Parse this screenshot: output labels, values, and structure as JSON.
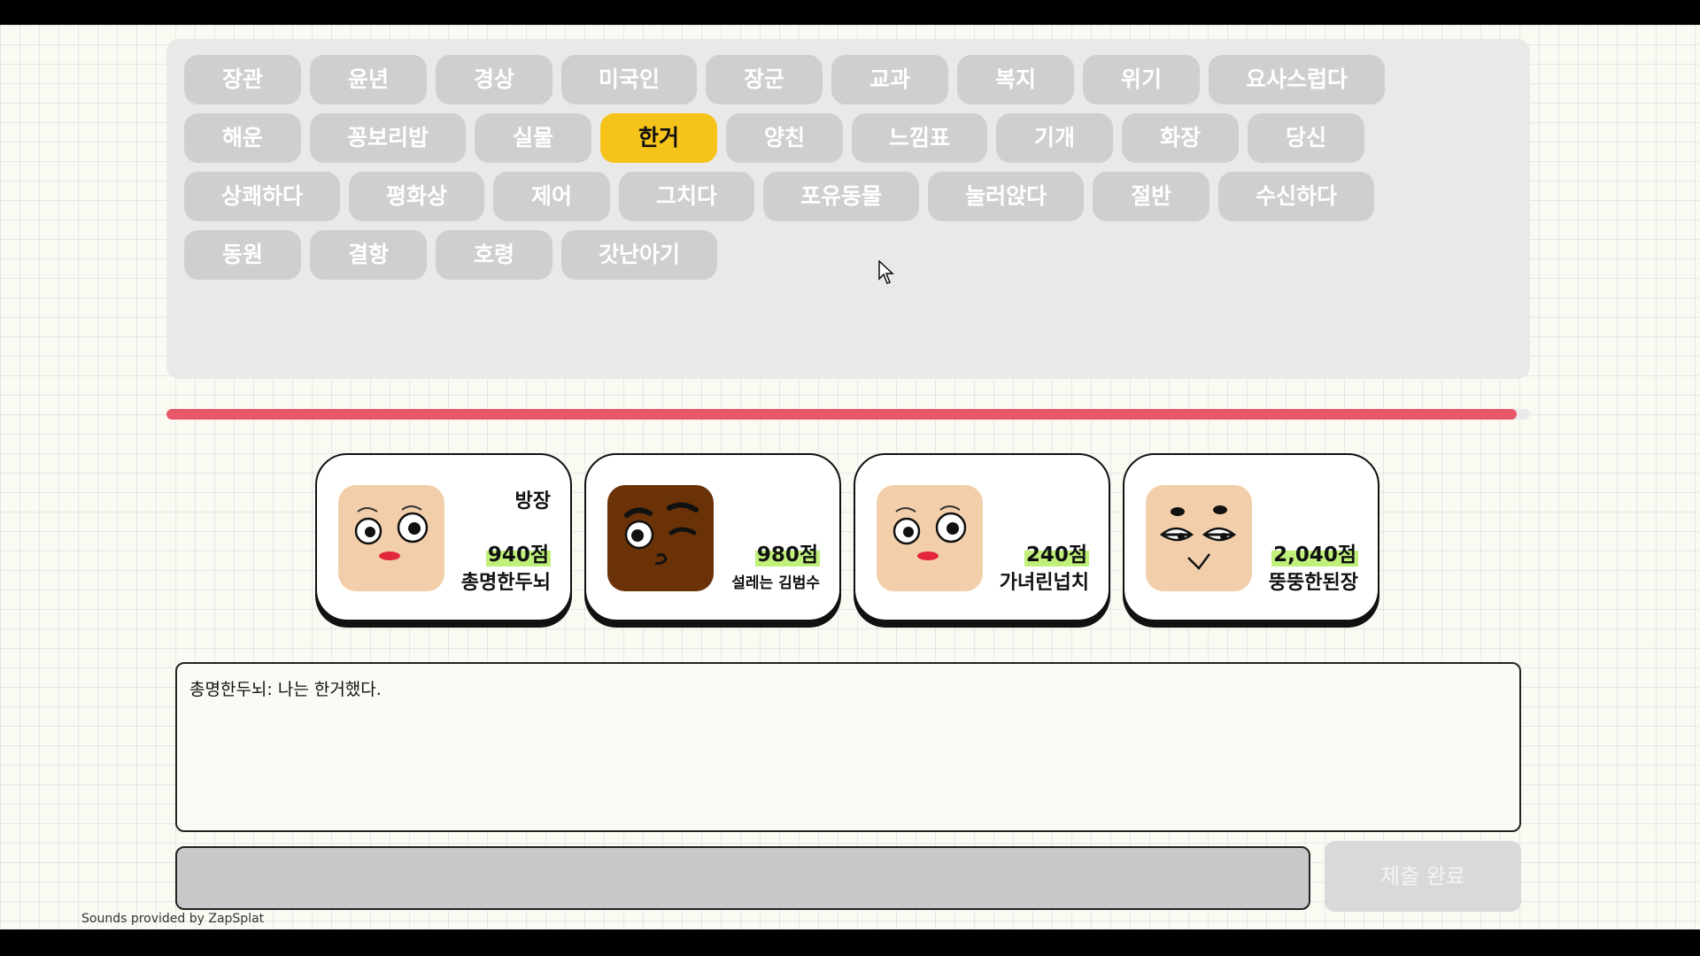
{
  "words": [
    {
      "label": "장관",
      "selected": false
    },
    {
      "label": "윤년",
      "selected": false
    },
    {
      "label": "경상",
      "selected": false
    },
    {
      "label": "미국인",
      "selected": false
    },
    {
      "label": "장군",
      "selected": false
    },
    {
      "label": "교과",
      "selected": false
    },
    {
      "label": "복지",
      "selected": false
    },
    {
      "label": "위기",
      "selected": false
    },
    {
      "label": "요사스럽다",
      "selected": false
    },
    {
      "label": "해운",
      "selected": false
    },
    {
      "label": "꽁보리밥",
      "selected": false
    },
    {
      "label": "실물",
      "selected": false
    },
    {
      "label": "한거",
      "selected": true
    },
    {
      "label": "양친",
      "selected": false
    },
    {
      "label": "느낌표",
      "selected": false
    },
    {
      "label": "기개",
      "selected": false
    },
    {
      "label": "화장",
      "selected": false
    },
    {
      "label": "당신",
      "selected": false
    },
    {
      "label": "상쾌하다",
      "selected": false
    },
    {
      "label": "평화상",
      "selected": false
    },
    {
      "label": "제어",
      "selected": false
    },
    {
      "label": "그치다",
      "selected": false
    },
    {
      "label": "포유동물",
      "selected": false
    },
    {
      "label": "눌러앉다",
      "selected": false
    },
    {
      "label": "절반",
      "selected": false
    },
    {
      "label": "수신하다",
      "selected": false
    },
    {
      "label": "동원",
      "selected": false
    },
    {
      "label": "결항",
      "selected": false
    },
    {
      "label": "호령",
      "selected": false
    },
    {
      "label": "갓난아기",
      "selected": false
    }
  ],
  "timer": {
    "progress": 0.99,
    "color": "#e8566a"
  },
  "players": [
    {
      "tag": "방장",
      "score": "940점",
      "name": "총명한두뇌",
      "avatar": "light-face-lipstick-icon"
    },
    {
      "tag": "",
      "score": "980점",
      "name": "설레는 김범수",
      "avatar": "dark-face-wink-icon"
    },
    {
      "tag": "",
      "score": "240점",
      "name": "가녀린넙치",
      "avatar": "light-face-lipstick-icon"
    },
    {
      "tag": "",
      "score": "2,040점",
      "name": "뚱뚱한된장",
      "avatar": "light-face-smirk-icon"
    }
  ],
  "chat": {
    "messages": [
      "총명한두뇌: 나는 한거했다."
    ]
  },
  "input": {
    "value": "",
    "placeholder": ""
  },
  "submit_label": "제출 완료",
  "credit": "Sounds provided by ZapSplat",
  "colors": {
    "selected": "#f6c31b",
    "chip": "#cfcfcf",
    "highlight": "#bff07a"
  }
}
